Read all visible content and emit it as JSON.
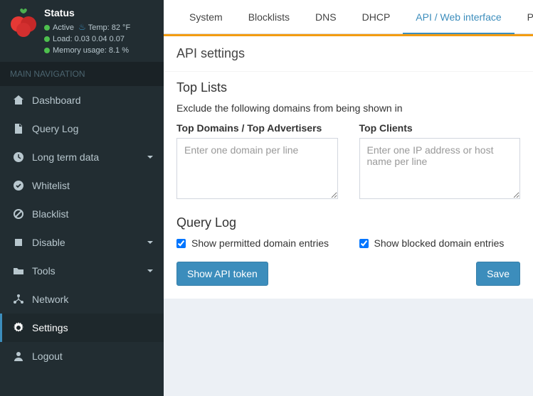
{
  "status": {
    "title": "Status",
    "active_label": "Active",
    "temp_label": "Temp:",
    "temp_value": "82 °F",
    "load_label": "Load:",
    "load_value": "0.03 0.04 0.07",
    "memory_label": "Memory usage:",
    "memory_value": "8.1 %"
  },
  "nav": {
    "header": "MAIN NAVIGATION",
    "items": [
      {
        "label": "Dashboard"
      },
      {
        "label": "Query Log"
      },
      {
        "label": "Long term data"
      },
      {
        "label": "Whitelist"
      },
      {
        "label": "Blacklist"
      },
      {
        "label": "Disable"
      },
      {
        "label": "Tools"
      },
      {
        "label": "Network"
      },
      {
        "label": "Settings"
      },
      {
        "label": "Logout"
      }
    ]
  },
  "tabs": {
    "system": "System",
    "blocklists": "Blocklists",
    "dns": "DNS",
    "dhcp": "DHCP",
    "api": "API / Web interface",
    "privacy": "Privac"
  },
  "panel": {
    "title": "API settings",
    "toplists_heading": "Top Lists",
    "toplists_desc": "Exclude the following domains from being shown in",
    "domains_label": "Top Domains / Top Advertisers",
    "domains_placeholder": "Enter one domain per line",
    "clients_label": "Top Clients",
    "clients_placeholder": "Enter one IP address or host name per line",
    "querylog_heading": "Query Log",
    "permitted_label": "Show permitted domain entries",
    "blocked_label": "Show blocked domain entries",
    "show_token_btn": "Show API token",
    "save_btn": "Save"
  }
}
